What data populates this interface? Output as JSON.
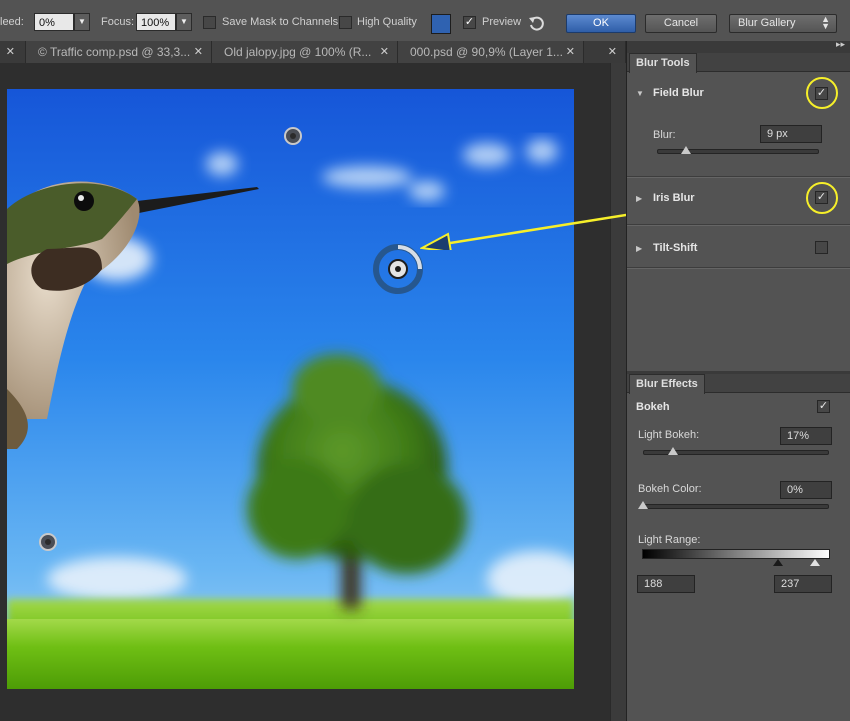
{
  "options_bar": {
    "bleed_label": "leed:",
    "bleed_value": "0%",
    "focus_label": "Focus:",
    "focus_value": "100%",
    "save_mask_label": "Save Mask to Channels",
    "high_quality_label": "High Quality",
    "preview_label": "Preview",
    "preview_checked": true,
    "ok_label": "OK",
    "cancel_label": "Cancel",
    "workspace_value": "Blur Gallery"
  },
  "tabs": [
    {
      "label": "© Traffic comp.psd @ 33,3..."
    },
    {
      "label": "Old jalopy.jpg @ 100% (R..."
    },
    {
      "label": "000.psd @ 90,9% (Layer 1..."
    }
  ],
  "blur_tools": {
    "title": "Blur Tools",
    "field_blur": {
      "label": "Field Blur",
      "checked": true,
      "blur_label": "Blur:",
      "blur_value": "9 px",
      "slider_fraction": 0.18
    },
    "iris_blur": {
      "label": "Iris Blur",
      "checked": true
    },
    "tilt_shift": {
      "label": "Tilt-Shift",
      "checked": false
    }
  },
  "blur_effects": {
    "title": "Blur Effects",
    "bokeh_label": "Bokeh",
    "bokeh_checked": true,
    "light_bokeh_label": "Light Bokeh:",
    "light_bokeh_value": "17%",
    "light_bokeh_fraction": 0.17,
    "bokeh_color_label": "Bokeh Color:",
    "bokeh_color_value": "0%",
    "bokeh_color_fraction": 0.0,
    "light_range_label": "Light Range:",
    "light_range_low": "188",
    "light_range_high": "237"
  },
  "colors": {
    "accent_highlight": "#f6ef2a",
    "panel_bg": "#535353",
    "ok_button": "#2f5ea8"
  }
}
